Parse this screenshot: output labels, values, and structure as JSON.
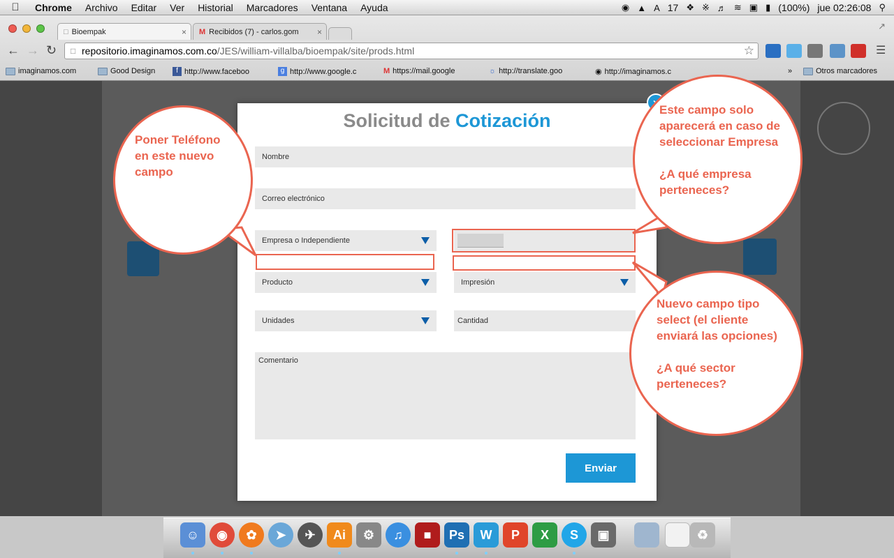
{
  "menubar": {
    "app": "Chrome",
    "items": [
      "Archivo",
      "Editar",
      "Ver",
      "Historial",
      "Marcadores",
      "Ventana",
      "Ayuda"
    ],
    "status_left_number": "17",
    "battery": "(100%)",
    "clock": "jue 02:26:08"
  },
  "tabs": [
    {
      "title": "Bioempak"
    },
    {
      "title": "Recibidos (7) - carlos.gom"
    }
  ],
  "address": {
    "host": "repositorio.imaginamos.com.co",
    "path": "/JES/william-villalba/bioempak/site/prods.html"
  },
  "bookmarks": {
    "items": [
      "imaginamos.com",
      "Good Design",
      "http://www.faceboo",
      "http://www.google.c",
      "https://mail.google",
      "http://translate.goo",
      "http://imaginamos.c"
    ],
    "overflow": "»",
    "other": "Otros marcadores"
  },
  "modal": {
    "title_a": "Solicitud de ",
    "title_b": "Cotización",
    "fields": {
      "nombre": "Nombre",
      "correo": "Correo electrónico",
      "empresa": "Empresa o Independiente",
      "producto": "Producto",
      "impresion": "Impresión",
      "unidades": "Unidades",
      "cantidad": "Cantidad",
      "comentario": "Comentario"
    },
    "send": "Enviar"
  },
  "annotations": {
    "left": "Poner Teléfono en este nuevo campo",
    "top_right_a": "Este campo solo aparecerá en caso de seleccionar Empresa",
    "top_right_b": "¿A qué empresa perteneces?",
    "bottom_right_a": "Nuevo campo tipo select (el cliente enviará las opciones)",
    "bottom_right_b": "¿A qué sector perteneces?"
  },
  "colors": {
    "accent": "#1d97d6",
    "annotation": "#ea6550"
  }
}
